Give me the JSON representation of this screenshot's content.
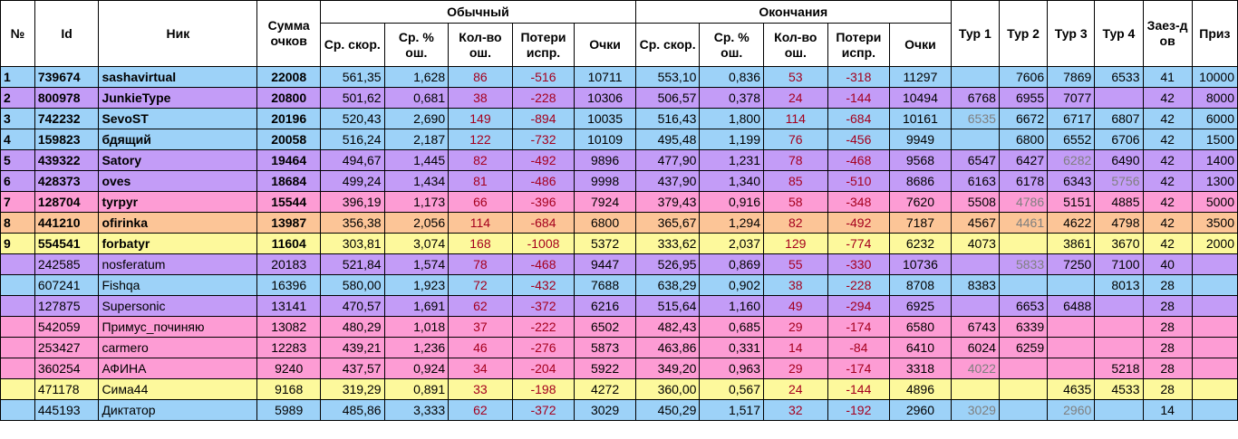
{
  "headers": {
    "num": "№",
    "id": "Id",
    "nick": "Ник",
    "sum": "Сумма очков",
    "group_normal": "Обычный",
    "group_endings": "Окончания",
    "speed": "Ср. скор.",
    "err_pct": "Ср. % ош.",
    "err_count": "Кол-во ош.",
    "loss": "Потери испр.",
    "points": "Очки",
    "tour1": "Тур 1",
    "tour2": "Тур 2",
    "tour3": "Тур 3",
    "tour4": "Тур 4",
    "races": "Заез-дов",
    "prize": "Приз"
  },
  "colors": {
    "blue": "#9dd2f8",
    "violet": "#c39cf7",
    "pink": "#fd9cd4",
    "orange": "#fcc597",
    "yellow": "#fdf99c",
    "error_red": "#a5001e",
    "muted_grey": "#7f7f7f"
  },
  "rows": [
    {
      "num": "1",
      "id": "739674",
      "nick": "sashavirtual",
      "sum": "22008",
      "color": "blue",
      "bold": true,
      "n_speed": "561,35",
      "n_errp": "1,628",
      "n_errc": "86",
      "n_loss": "-516",
      "n_pts": "10711",
      "e_speed": "553,10",
      "e_errp": "0,836",
      "e_errc": "53",
      "e_loss": "-318",
      "e_pts": "11297",
      "t1": "",
      "t2": "7606",
      "t3": "7869",
      "t4": "6533",
      "t1_grey": false,
      "t2_grey": false,
      "t3_grey": false,
      "t4_grey": false,
      "races": "41",
      "prize": "10000"
    },
    {
      "num": "2",
      "id": "800978",
      "nick": "JunkieType",
      "sum": "20800",
      "color": "violet",
      "bold": true,
      "n_speed": "501,62",
      "n_errp": "0,681",
      "n_errc": "38",
      "n_loss": "-228",
      "n_pts": "10306",
      "e_speed": "506,57",
      "e_errp": "0,378",
      "e_errc": "24",
      "e_loss": "-144",
      "e_pts": "10494",
      "t1": "6768",
      "t2": "6955",
      "t3": "7077",
      "t4": "",
      "t1_grey": false,
      "t2_grey": false,
      "t3_grey": false,
      "t4_grey": false,
      "races": "42",
      "prize": "8000"
    },
    {
      "num": "3",
      "id": "742232",
      "nick": "SevoST",
      "sum": "20196",
      "color": "blue",
      "bold": true,
      "n_speed": "520,43",
      "n_errp": "2,690",
      "n_errc": "149",
      "n_loss": "-894",
      "n_pts": "10035",
      "e_speed": "516,43",
      "e_errp": "1,800",
      "e_errc": "114",
      "e_loss": "-684",
      "e_pts": "10161",
      "t1": "6535",
      "t2": "6672",
      "t3": "6717",
      "t4": "6807",
      "t1_grey": true,
      "t2_grey": false,
      "t3_grey": false,
      "t4_grey": false,
      "races": "42",
      "prize": "6000"
    },
    {
      "num": "4",
      "id": "159823",
      "nick": "бдящий",
      "sum": "20058",
      "color": "blue",
      "bold": true,
      "n_speed": "516,24",
      "n_errp": "2,187",
      "n_errc": "122",
      "n_loss": "-732",
      "n_pts": "10109",
      "e_speed": "495,48",
      "e_errp": "1,199",
      "e_errc": "76",
      "e_loss": "-456",
      "e_pts": "9949",
      "t1": "",
      "t2": "6800",
      "t3": "6552",
      "t4": "6706",
      "t1_grey": false,
      "t2_grey": false,
      "t3_grey": false,
      "t4_grey": false,
      "races": "42",
      "prize": "1500"
    },
    {
      "num": "5",
      "id": "439322",
      "nick": "Satory",
      "sum": "19464",
      "color": "violet",
      "bold": true,
      "n_speed": "494,67",
      "n_errp": "1,445",
      "n_errc": "82",
      "n_loss": "-492",
      "n_pts": "9896",
      "e_speed": "477,90",
      "e_errp": "1,231",
      "e_errc": "78",
      "e_loss": "-468",
      "e_pts": "9568",
      "t1": "6547",
      "t2": "6427",
      "t3": "6282",
      "t4": "6490",
      "t1_grey": false,
      "t2_grey": false,
      "t3_grey": true,
      "t4_grey": false,
      "races": "42",
      "prize": "1400"
    },
    {
      "num": "6",
      "id": "428373",
      "nick": "oves",
      "sum": "18684",
      "color": "violet",
      "bold": true,
      "n_speed": "499,24",
      "n_errp": "1,434",
      "n_errc": "81",
      "n_loss": "-486",
      "n_pts": "9998",
      "e_speed": "437,90",
      "e_errp": "1,340",
      "e_errc": "85",
      "e_loss": "-510",
      "e_pts": "8686",
      "t1": "6163",
      "t2": "6178",
      "t3": "6343",
      "t4": "5756",
      "t1_grey": false,
      "t2_grey": false,
      "t3_grey": false,
      "t4_grey": true,
      "races": "42",
      "prize": "1300"
    },
    {
      "num": "7",
      "id": "128704",
      "nick": "tyrpyr",
      "sum": "15544",
      "color": "pink",
      "bold": true,
      "n_speed": "396,19",
      "n_errp": "1,173",
      "n_errc": "66",
      "n_loss": "-396",
      "n_pts": "7924",
      "e_speed": "379,43",
      "e_errp": "0,916",
      "e_errc": "58",
      "e_loss": "-348",
      "e_pts": "7620",
      "t1": "5508",
      "t2": "4786",
      "t3": "5151",
      "t4": "4885",
      "t1_grey": false,
      "t2_grey": true,
      "t3_grey": false,
      "t4_grey": false,
      "races": "42",
      "prize": "5000"
    },
    {
      "num": "8",
      "id": "441210",
      "nick": "ofirinka",
      "sum": "13987",
      "color": "orange",
      "bold": true,
      "n_speed": "356,38",
      "n_errp": "2,056",
      "n_errc": "114",
      "n_loss": "-684",
      "n_pts": "6800",
      "e_speed": "365,67",
      "e_errp": "1,294",
      "e_errc": "82",
      "e_loss": "-492",
      "e_pts": "7187",
      "t1": "4567",
      "t2": "4461",
      "t3": "4622",
      "t4": "4798",
      "t1_grey": false,
      "t2_grey": true,
      "t3_grey": false,
      "t4_grey": false,
      "races": "42",
      "prize": "3500"
    },
    {
      "num": "9",
      "id": "554541",
      "nick": "forbatyr",
      "sum": "11604",
      "color": "yellow",
      "bold": true,
      "n_speed": "303,81",
      "n_errp": "3,074",
      "n_errc": "168",
      "n_loss": "-1008",
      "n_pts": "5372",
      "e_speed": "333,62",
      "e_errp": "2,037",
      "e_errc": "129",
      "e_loss": "-774",
      "e_pts": "6232",
      "t1": "4073",
      "t2": "",
      "t3": "3861",
      "t4": "3670",
      "t1_grey": false,
      "t2_grey": false,
      "t3_grey": false,
      "t4_grey": false,
      "races": "42",
      "prize": "2000"
    },
    {
      "num": "",
      "id": "242585",
      "nick": "nosferatum",
      "sum": "20183",
      "color": "violet",
      "bold": false,
      "n_speed": "521,84",
      "n_errp": "1,574",
      "n_errc": "78",
      "n_loss": "-468",
      "n_pts": "9447",
      "e_speed": "526,95",
      "e_errp": "0,869",
      "e_errc": "55",
      "e_loss": "-330",
      "e_pts": "10736",
      "t1": "",
      "t2": "5833",
      "t3": "7250",
      "t4": "7100",
      "t1_grey": false,
      "t2_grey": true,
      "t3_grey": false,
      "t4_grey": false,
      "races": "40",
      "prize": ""
    },
    {
      "num": "",
      "id": "607241",
      "nick": "Fishqa",
      "sum": "16396",
      "color": "blue",
      "bold": false,
      "n_speed": "580,00",
      "n_errp": "1,923",
      "n_errc": "72",
      "n_loss": "-432",
      "n_pts": "7688",
      "e_speed": "638,29",
      "e_errp": "0,902",
      "e_errc": "38",
      "e_loss": "-228",
      "e_pts": "8708",
      "t1": "8383",
      "t2": "",
      "t3": "",
      "t4": "8013",
      "t1_grey": false,
      "t2_grey": false,
      "t3_grey": false,
      "t4_grey": false,
      "races": "28",
      "prize": ""
    },
    {
      "num": "",
      "id": "127875",
      "nick": "Supersonic",
      "sum": "13141",
      "color": "violet",
      "bold": false,
      "n_speed": "470,57",
      "n_errp": "1,691",
      "n_errc": "62",
      "n_loss": "-372",
      "n_pts": "6216",
      "e_speed": "515,64",
      "e_errp": "1,160",
      "e_errc": "49",
      "e_loss": "-294",
      "e_pts": "6925",
      "t1": "",
      "t2": "6653",
      "t3": "6488",
      "t4": "",
      "t1_grey": false,
      "t2_grey": false,
      "t3_grey": false,
      "t4_grey": false,
      "races": "28",
      "prize": ""
    },
    {
      "num": "",
      "id": "542059",
      "nick": "Примус_починяю",
      "sum": "13082",
      "color": "pink",
      "bold": false,
      "n_speed": "480,29",
      "n_errp": "1,018",
      "n_errc": "37",
      "n_loss": "-222",
      "n_pts": "6502",
      "e_speed": "482,43",
      "e_errp": "0,685",
      "e_errc": "29",
      "e_loss": "-174",
      "e_pts": "6580",
      "t1": "6743",
      "t2": "6339",
      "t3": "",
      "t4": "",
      "t1_grey": false,
      "t2_grey": false,
      "t3_grey": false,
      "t4_grey": false,
      "races": "28",
      "prize": ""
    },
    {
      "num": "",
      "id": "253427",
      "nick": "carmero",
      "sum": "12283",
      "color": "pink",
      "bold": false,
      "n_speed": "439,21",
      "n_errp": "1,236",
      "n_errc": "46",
      "n_loss": "-276",
      "n_pts": "5873",
      "e_speed": "463,86",
      "e_errp": "0,331",
      "e_errc": "14",
      "e_loss": "-84",
      "e_pts": "6410",
      "t1": "6024",
      "t2": "6259",
      "t3": "",
      "t4": "",
      "t1_grey": false,
      "t2_grey": false,
      "t3_grey": false,
      "t4_grey": false,
      "races": "28",
      "prize": ""
    },
    {
      "num": "",
      "id": "360254",
      "nick": "АФИНА",
      "sum": "9240",
      "color": "pink",
      "bold": false,
      "n_speed": "437,57",
      "n_errp": "0,924",
      "n_errc": "34",
      "n_loss": "-204",
      "n_pts": "5922",
      "e_speed": "349,20",
      "e_errp": "0,963",
      "e_errc": "29",
      "e_loss": "-174",
      "e_pts": "3318",
      "t1": "4022",
      "t2": "",
      "t3": "",
      "t4": "5218",
      "t1_grey": true,
      "t2_grey": false,
      "t3_grey": false,
      "t4_grey": false,
      "races": "28",
      "prize": ""
    },
    {
      "num": "",
      "id": "471178",
      "nick": "Сима44",
      "sum": "9168",
      "color": "yellow",
      "bold": false,
      "n_speed": "319,29",
      "n_errp": "0,891",
      "n_errc": "33",
      "n_loss": "-198",
      "n_pts": "4272",
      "e_speed": "360,00",
      "e_errp": "0,567",
      "e_errc": "24",
      "e_loss": "-144",
      "e_pts": "4896",
      "t1": "",
      "t2": "",
      "t3": "4635",
      "t4": "4533",
      "t1_grey": false,
      "t2_grey": false,
      "t3_grey": false,
      "t4_grey": false,
      "races": "28",
      "prize": ""
    },
    {
      "num": "",
      "id": "445193",
      "nick": "Диктатор",
      "sum": "5989",
      "color": "blue",
      "bold": false,
      "n_speed": "485,86",
      "n_errp": "3,333",
      "n_errc": "62",
      "n_loss": "-372",
      "n_pts": "3029",
      "e_speed": "450,29",
      "e_errp": "1,517",
      "e_errc": "32",
      "e_loss": "-192",
      "e_pts": "2960",
      "t1": "3029",
      "t2": "",
      "t3": "2960",
      "t4": "",
      "t1_grey": true,
      "t2_grey": false,
      "t3_grey": true,
      "t4_grey": false,
      "races": "14",
      "prize": ""
    }
  ]
}
